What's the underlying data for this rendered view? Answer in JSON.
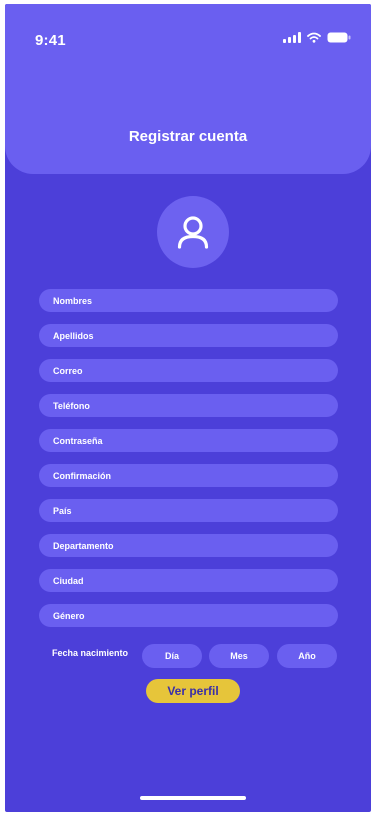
{
  "status_bar": {
    "time": "9:41",
    "signal_icon": "signal-icon",
    "wifi_icon": "wifi-icon",
    "battery_icon": "battery-icon"
  },
  "header": {
    "title": "Registrar cuenta"
  },
  "avatar": {
    "icon": "user-icon"
  },
  "form": {
    "fields": [
      {
        "label": "Nombres"
      },
      {
        "label": "Apellidos"
      },
      {
        "label": "Correo"
      },
      {
        "label": "Teléfono"
      },
      {
        "label": "Contraseña"
      },
      {
        "label": "Confirmación"
      },
      {
        "label": "País"
      },
      {
        "label": "Departamento"
      },
      {
        "label": "Ciudad"
      },
      {
        "label": "Género"
      }
    ],
    "birth_date": {
      "label": "Fecha nacimiento",
      "day": "Día",
      "month": "Mes",
      "year": "Año"
    }
  },
  "actions": {
    "view_profile": "Ver perfil"
  },
  "colors": {
    "background": "#4c3fd9",
    "header": "#6a5ff0",
    "field": "#6a5ff0",
    "button": "#e6c53a"
  }
}
